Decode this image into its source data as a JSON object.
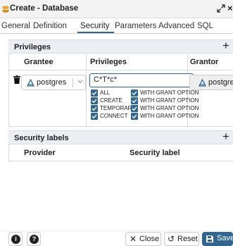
{
  "dialog": {
    "title": "Create - Database",
    "close_glyph": "×"
  },
  "tabs": [
    {
      "label": "General"
    },
    {
      "label": "Definition"
    },
    {
      "label": "Security",
      "active": true
    },
    {
      "label": "Parameters"
    },
    {
      "label": "Advanced"
    },
    {
      "label": "SQL"
    }
  ],
  "privileges": {
    "section_label": "Privileges",
    "add_glyph": "+",
    "columns": {
      "grantee": "Grantee",
      "privileges": "Privileges",
      "grantor": "Grantor"
    },
    "row": {
      "grantee": "postgres",
      "privileges_value": "C*T*c*",
      "grantor": "postgres",
      "items": [
        {
          "label": "ALL",
          "checked": true
        },
        {
          "label": "WITH GRANT OPTION",
          "checked": true
        },
        {
          "label": "CREATE",
          "checked": true
        },
        {
          "label": "WITH GRANT OPTION",
          "checked": true
        },
        {
          "label": "TEMPORARY",
          "checked": true
        },
        {
          "label": "WITH GRANT OPTION",
          "checked": true
        },
        {
          "label": "CONNECT",
          "checked": true
        },
        {
          "label": "WITH GRANT OPTION",
          "checked": true
        }
      ]
    }
  },
  "security_labels": {
    "section_label": "Security labels",
    "add_glyph": "+",
    "columns": {
      "provider": "Provider",
      "label": "Security label"
    }
  },
  "footer": {
    "info_glyph": "i",
    "help_glyph": "?",
    "close_label": "Close",
    "close_glyph": "✕",
    "reset_label": "Reset",
    "reset_glyph": "↺",
    "save_label": "Save"
  },
  "colors": {
    "accent": "#326690",
    "section_bg": "#ebeef3",
    "db_icon": "#e8a33d"
  }
}
